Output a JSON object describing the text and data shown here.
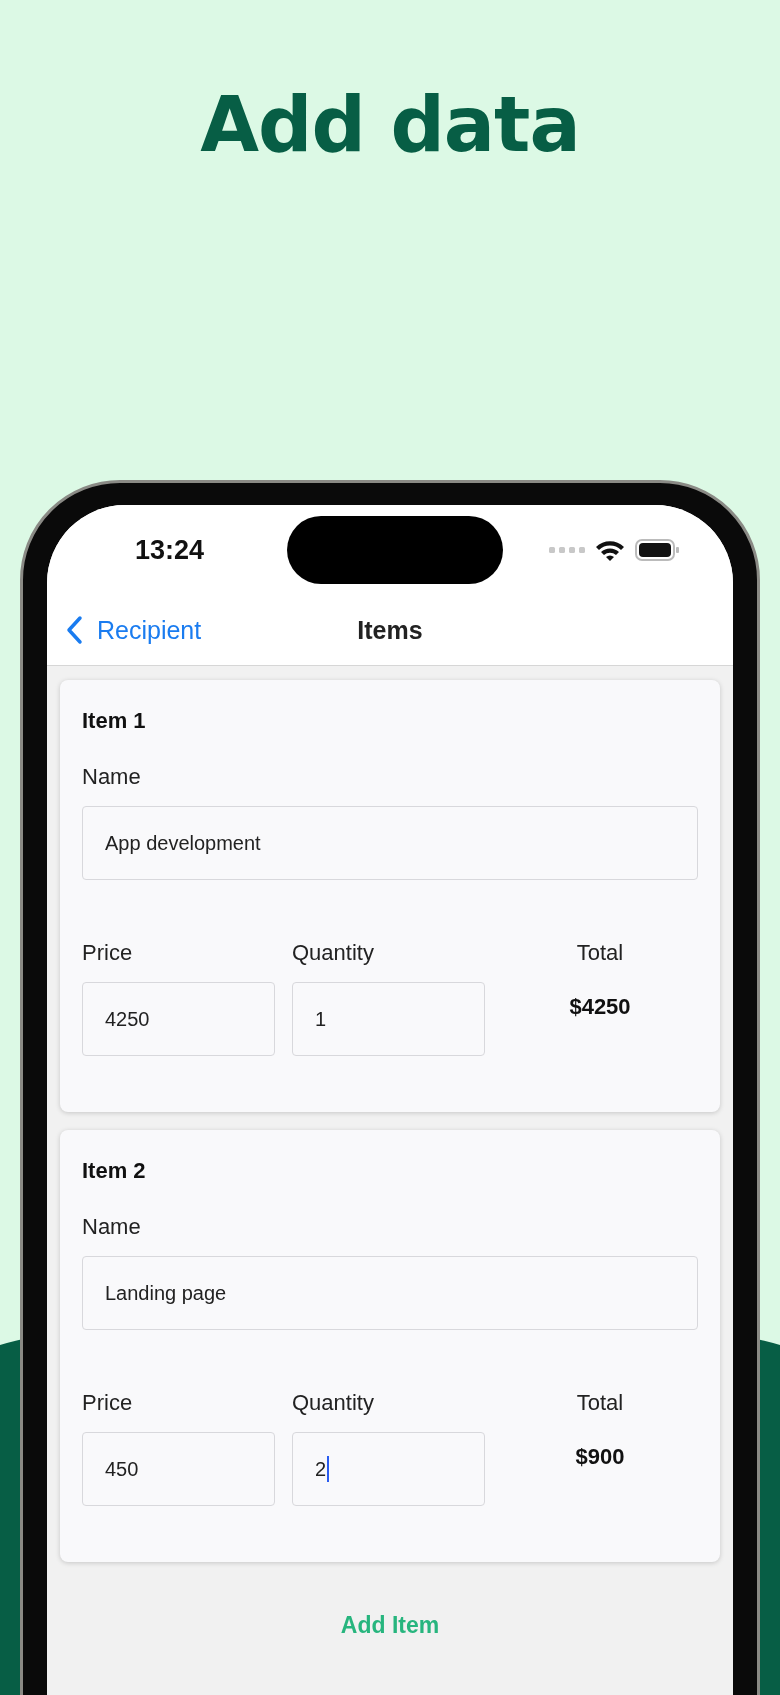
{
  "headline": "Add data",
  "status_bar": {
    "time": "13:24"
  },
  "nav": {
    "back": "Recipient",
    "title": "Items"
  },
  "items": [
    {
      "heading": "Item 1",
      "name_label": "Name",
      "name": "App development",
      "price_label": "Price",
      "price": "4250",
      "quantity_label": "Quantity",
      "quantity": "1",
      "quantity_focused": false,
      "total_label": "Total",
      "total": "$4250"
    },
    {
      "heading": "Item 2",
      "name_label": "Name",
      "name": "Landing page",
      "price_label": "Price",
      "price": "450",
      "quantity_label": "Quantity",
      "quantity": "2",
      "quantity_focused": true,
      "total_label": "Total",
      "total": "$900"
    }
  ],
  "add_button": "Add Item"
}
